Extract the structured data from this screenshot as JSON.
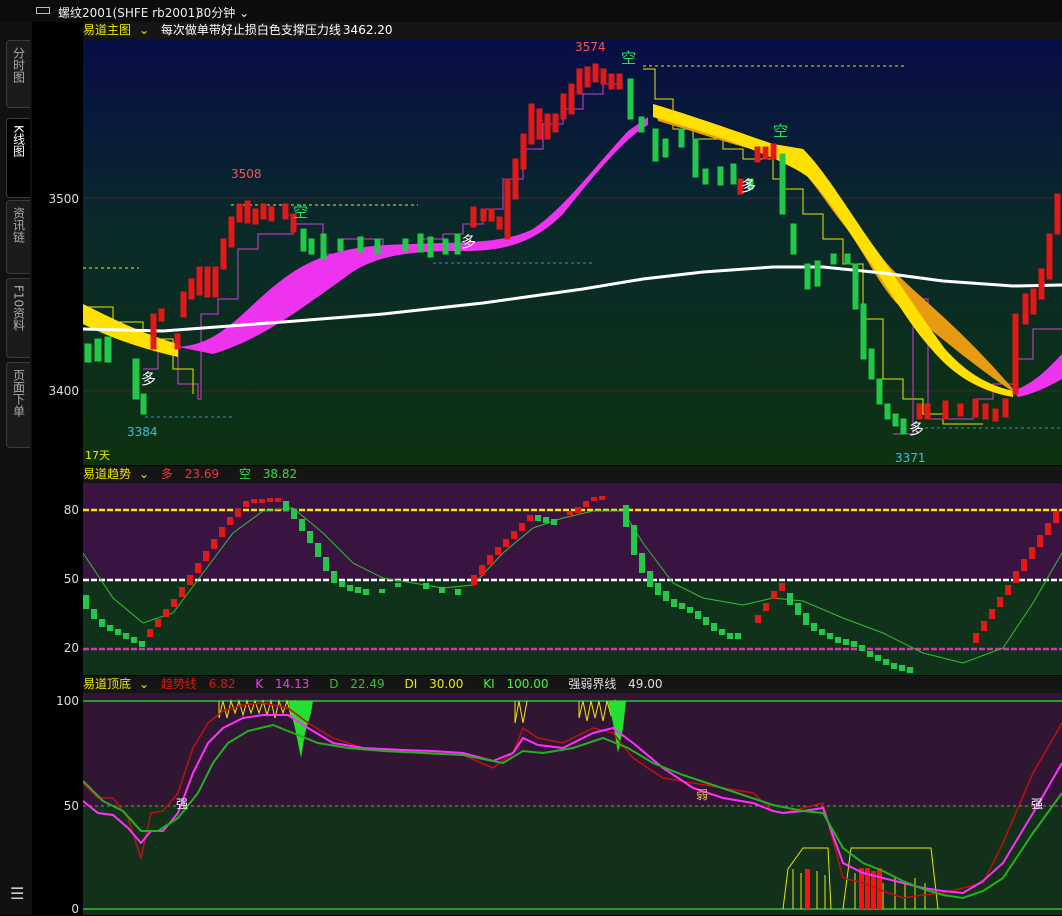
{
  "window": {
    "symbol": "螺纹2001(SHFE rb2001)",
    "period": "30分钟",
    "colors": {
      "up": "#ff1a1a",
      "down": "#22c84a",
      "background": "#000000"
    }
  },
  "sidebar": {
    "tabs": [
      {
        "label": "分时图",
        "active": false
      },
      {
        "label": "K线图",
        "active": true
      },
      {
        "label": "资讯链",
        "active": false
      },
      {
        "label": "F10资料",
        "active": false
      },
      {
        "label": "页面下单",
        "active": false
      }
    ]
  },
  "main": {
    "indicator": "易道主图",
    "desc": "每次做单带好止损白色支撑压力线",
    "value": "3462.20",
    "yticks": [
      "3500",
      "3400"
    ],
    "annotations": {
      "high1": "3508",
      "high2": "3574",
      "low1": "3384",
      "low2": "3371",
      "buy": "多",
      "sell": "空",
      "days": "17天"
    }
  },
  "trend": {
    "indicator": "易道趋势",
    "long_label": "多",
    "long_value": "23.69",
    "short_label": "空",
    "short_value": "38.82",
    "yticks": [
      "80",
      "50",
      "20"
    ]
  },
  "topbottom": {
    "indicator": "易道顶底",
    "trend_label": "趋势线",
    "trend_value": "6.82",
    "k_label": "K",
    "k_value": "14.13",
    "d_label": "D",
    "d_value": "22.49",
    "di_label": "DI",
    "di_value": "30.00",
    "ki_label": "KI",
    "ki_value": "100.00",
    "sep_label": "强弱界线",
    "sep_value": "49.00",
    "yticks": [
      "100",
      "50",
      "0"
    ],
    "strong": "强",
    "weak": "弱"
  }
}
